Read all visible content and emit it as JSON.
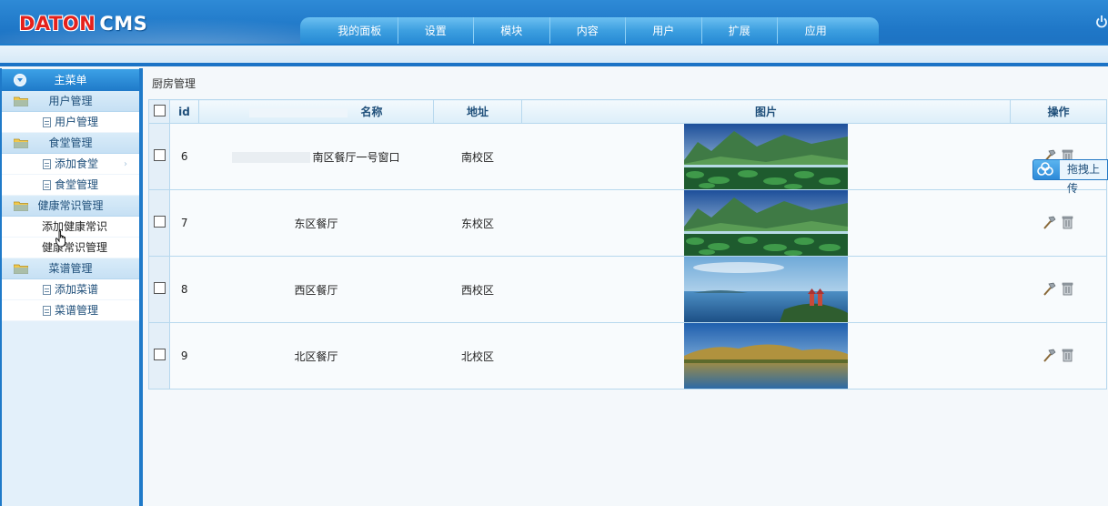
{
  "header": {
    "logo_part1": "DATON",
    "logo_part2": "CMS",
    "nav": [
      "我的面板",
      "设置",
      "模块",
      "内容",
      "用户",
      "扩展",
      "应用"
    ],
    "power_icon": "power-icon"
  },
  "sidebar": {
    "title": "主菜单",
    "groups": [
      {
        "label": "用户管理",
        "items": [
          "用户管理"
        ]
      },
      {
        "label": "食堂管理",
        "items": [
          "添加食堂",
          "食堂管理"
        ]
      },
      {
        "label": "健康常识管理",
        "items": [
          "添加健康常识",
          "健康常识管理"
        ]
      },
      {
        "label": "菜谱管理",
        "items": [
          "添加菜谱",
          "菜谱管理"
        ]
      }
    ]
  },
  "main": {
    "breadcrumb": "厨房管理",
    "table": {
      "headers": [
        "id",
        "名称",
        "地址",
        "图片",
        "操作"
      ],
      "rows": [
        {
          "id": "6",
          "name": "南区餐厅一号窗口",
          "address": "南校区",
          "image": "mountain-lake"
        },
        {
          "id": "7",
          "name": "东区餐厅",
          "address": "东校区",
          "image": "mountain-lake"
        },
        {
          "id": "8",
          "name": "西区餐厅",
          "address": "西校区",
          "image": "sea-island"
        },
        {
          "id": "9",
          "name": "北区餐厅",
          "address": "北校区",
          "image": "hill-lake"
        }
      ]
    },
    "drag_upload": "拖拽上传"
  },
  "colors": {
    "header_blue": "#1f77c7",
    "logo_red": "#e4211c",
    "table_border": "#b7d8ee"
  }
}
